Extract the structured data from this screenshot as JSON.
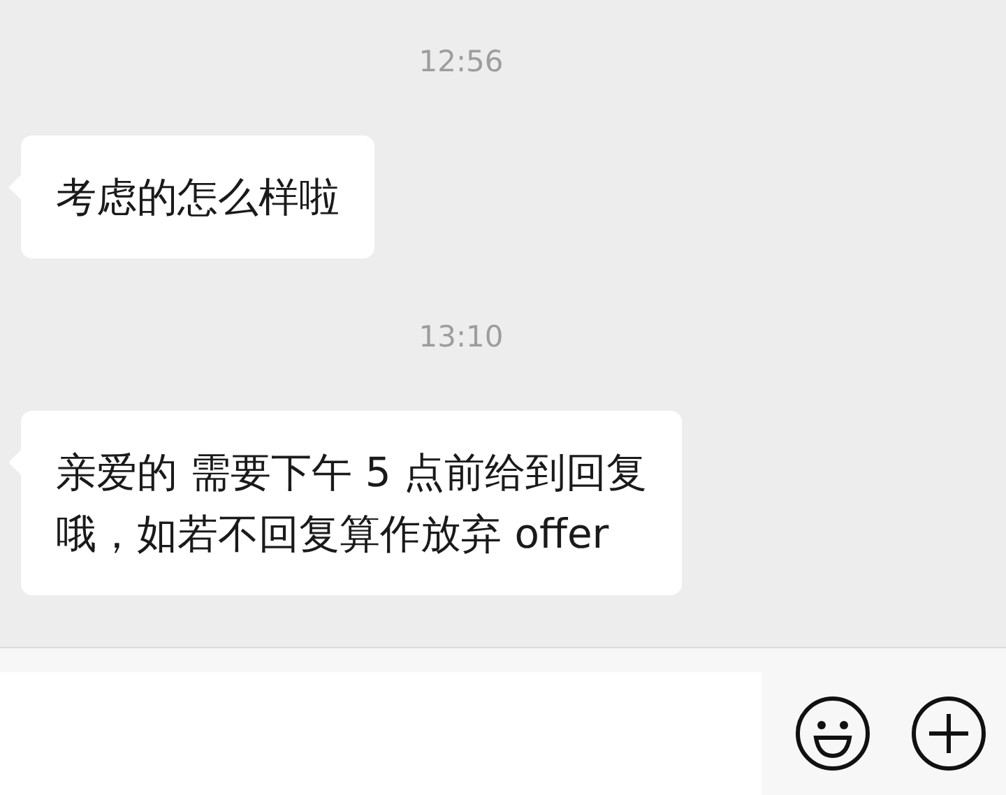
{
  "messages": [
    {
      "time": "12:56",
      "lines": [
        "考虑的怎么样啦"
      ]
    },
    {
      "time": "13:10",
      "lines": [
        "亲爱的 需要下午 5 点前给到回复",
        "哦，如若不回复算作放弃 offer"
      ]
    }
  ],
  "input_bar": {
    "buttons": [
      {
        "kind": "emoji"
      },
      {
        "kind": "plus"
      }
    ]
  }
}
